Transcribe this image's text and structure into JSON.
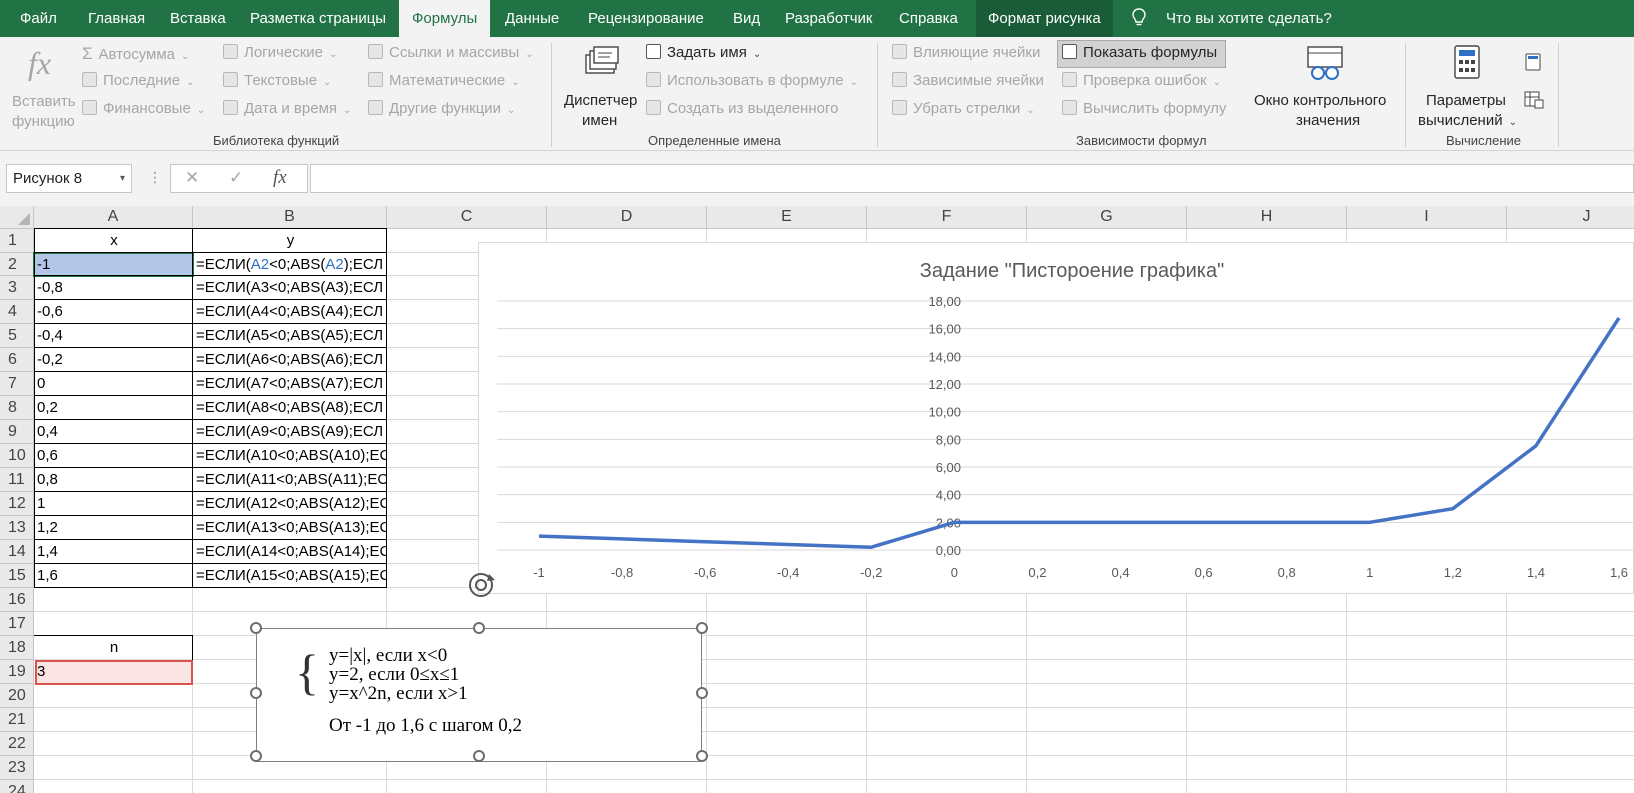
{
  "tabs": [
    "Файл",
    "Главная",
    "Вставка",
    "Разметка страницы",
    "Формулы",
    "Данные",
    "Рецензирование",
    "Вид",
    "Разработчик",
    "Справка",
    "Формат рисунка"
  ],
  "active_tab": "Формулы",
  "tell_me": "Что вы хотите сделать?",
  "ribbon": {
    "insert_function": [
      "Вставить",
      "функцию"
    ],
    "autosum": "Автосумма",
    "recent": "Последние",
    "financial": "Финансовые",
    "logical": "Логические",
    "text": "Текстовые",
    "datetime": "Дата и время",
    "lookup": "Ссылки и массивы",
    "math": "Математические",
    "more_functions": "Другие функции",
    "group_library": "Библиотека функций",
    "name_manager": [
      "Диспетчер",
      "имен"
    ],
    "define_name": "Задать имя",
    "use_in_formula": "Использовать в формуле",
    "create_from_selection": "Создать из выделенного",
    "group_names": "Определенные имена",
    "trace_precedents": "Влияющие ячейки",
    "trace_dependents": "Зависимые ячейки",
    "remove_arrows": "Убрать стрелки",
    "show_formulas": "Показать формулы",
    "error_checking": "Проверка ошибок",
    "evaluate_formula": "Вычислить формулу",
    "group_auditing": "Зависимости формул",
    "watch_window": [
      "Окно контрольного",
      "значения"
    ],
    "calc_options": [
      "Параметры",
      "вычислений"
    ],
    "group_calc": "Вычисление"
  },
  "formula_bar": {
    "name_box": "Рисунок 8",
    "cancel": "✕",
    "enter": "✓",
    "fx": "fx",
    "content": ""
  },
  "columns": [
    "A",
    "B",
    "C",
    "D",
    "E",
    "F",
    "G",
    "H",
    "I",
    "J"
  ],
  "rows": [
    "1",
    "2",
    "3",
    "4",
    "5",
    "6",
    "7",
    "8",
    "9",
    "10",
    "11",
    "12",
    "13",
    "14",
    "15",
    "16",
    "17",
    "18",
    "19",
    "20",
    "21",
    "22",
    "23",
    "24"
  ],
  "table": {
    "header_x": "x",
    "header_y": "y",
    "x_values": [
      "-1",
      "-0,8",
      "-0,6",
      "-0,4",
      "-0,2",
      "0",
      "0,2",
      "0,4",
      "0,6",
      "0,8",
      "1",
      "1,2",
      "1,4",
      "1,6"
    ],
    "formulas": [
      "=ЕСЛИ(A2<0;ABS(A2);ЕСЛ",
      "=ЕСЛИ(A3<0;ABS(A3);ЕСЛ",
      "=ЕСЛИ(A4<0;ABS(A4);ЕСЛ",
      "=ЕСЛИ(A5<0;ABS(A5);ЕСЛ",
      "=ЕСЛИ(A6<0;ABS(A6);ЕСЛ",
      "=ЕСЛИ(A7<0;ABS(A7);ЕСЛ",
      "=ЕСЛИ(A8<0;ABS(A8);ЕСЛ",
      "=ЕСЛИ(A9<0;ABS(A9);ЕСЛ",
      "=ЕСЛИ(A10<0;ABS(A10);ЕС",
      "=ЕСЛИ(A11<0;ABS(A11);ЕС",
      "=ЕСЛИ(A12<0;ABS(A12);ЕС",
      "=ЕСЛИ(A13<0;ABS(A13);ЕС",
      "=ЕСЛИ(A14<0;ABS(A14);ЕС",
      "=ЕСЛИ(A15<0;ABS(A15);ЕС"
    ],
    "n_label": "n",
    "n_value": "3"
  },
  "textbox": {
    "line1": "y=|x|, если x<0",
    "line2": "y=2, если 0≤x≤1",
    "line3": "y=x^2n, если x>1",
    "line4": "От -1 до 1,6 с шагом 0,2"
  },
  "chart_data": {
    "type": "line",
    "title": "Задание \"Пистороение графика\"",
    "x": [
      -1,
      -0.8,
      -0.6,
      -0.4,
      -0.2,
      0,
      0.2,
      0.4,
      0.6,
      0.8,
      1,
      1.2,
      1.4,
      1.6
    ],
    "x_labels": [
      "-1",
      "-0,8",
      "-0,6",
      "-0,4",
      "-0,2",
      "0",
      "0,2",
      "0,4",
      "0,6",
      "0,8",
      "1",
      "1,2",
      "1,4",
      "1,6"
    ],
    "values": [
      1,
      0.8,
      0.6,
      0.4,
      0.2,
      2,
      2,
      2,
      2,
      2,
      2,
      2.985984,
      7.529536,
      16.777216
    ],
    "ylim": [
      0,
      18
    ],
    "y_ticks": [
      "0,00",
      "2,00",
      "4,00",
      "6,00",
      "8,00",
      "10,00",
      "12,00",
      "14,00",
      "16,00",
      "18,00"
    ],
    "grid": true,
    "line_color": "#4472c4"
  }
}
